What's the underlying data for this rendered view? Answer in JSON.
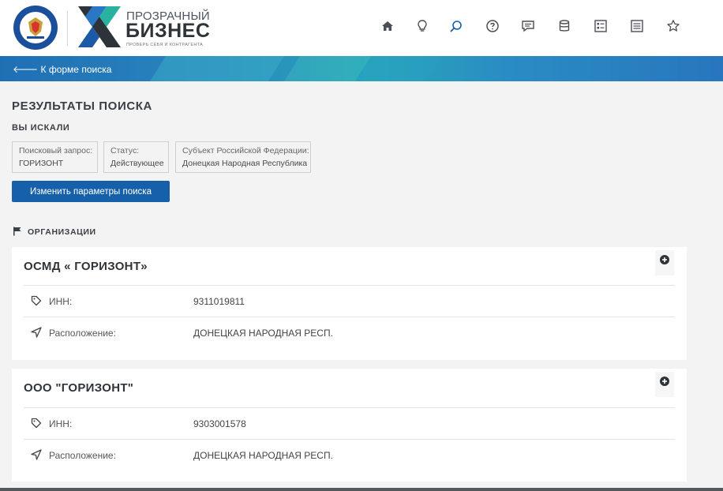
{
  "header": {
    "fns_logo_text": "ФЕДЕРАЛЬНАЯ НАЛОГОВАЯ СЛУЖБА",
    "brand_line1": "ПРОЗРАЧНЫЙ",
    "brand_line2": "БИЗНЕС",
    "brand_tagline": "ПРОВЕРЬ СЕБЯ И КОНТРАГЕНТА",
    "nav_icons": [
      "home-icon",
      "lightbulb-icon",
      "search-icon",
      "help-icon",
      "chat-icon",
      "database-icon",
      "checklist-icon",
      "list-icon",
      "star-icon"
    ],
    "active_icon": "search-icon"
  },
  "back_link": "🡐 К форме поиска",
  "page_title": "РЕЗУЛЬТАТЫ ПОИСКА",
  "subtitle": "ВЫ ИСКАЛИ",
  "criteria": [
    {
      "label": "Поисковый запрос:",
      "value": "ГОРИЗОНТ"
    },
    {
      "label": "Статус:",
      "value": "Действующее"
    },
    {
      "label": "Субъект Российской Федерации:",
      "value": "Донецкая Народная Республика"
    }
  ],
  "change_button": "Изменить параметры поиска",
  "section_title": "ОРГАНИЗАЦИИ",
  "results": [
    {
      "name": "ОСМД « ГОРИЗОНТ»",
      "inn_label": "ИНН:",
      "inn": "9311019811",
      "loc_label": "Расположение:",
      "location": "ДОНЕЦКАЯ НАРОДНАЯ РЕСП."
    },
    {
      "name": "ООО \"ГОРИЗОНТ\"",
      "inn_label": "ИНН:",
      "inn": "9303001578",
      "loc_label": "Расположение:",
      "location": "ДОНЕЦКАЯ НАРОДНАЯ РЕСП."
    }
  ],
  "colors": {
    "primary": "#1560a8",
    "accent": "#27a7b8",
    "background": "#f3f3f3"
  }
}
